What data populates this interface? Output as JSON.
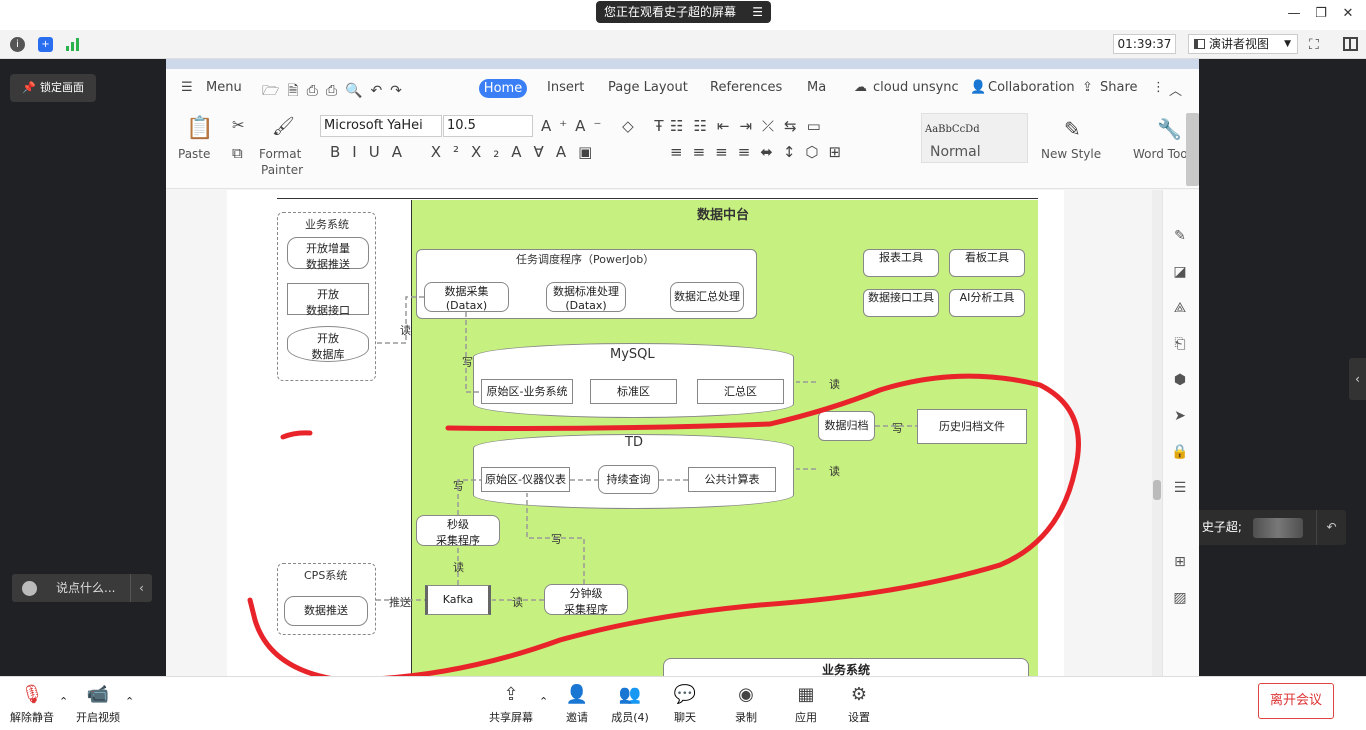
{
  "window": {
    "share_banner": "您正在观看史子超的屏幕",
    "timer": "01:39:37",
    "view_mode": "演讲者视图"
  },
  "left_panel": {
    "lock_label": "锁定画面",
    "chat_placeholder": "说点什么..."
  },
  "speaking": {
    "label": "正在讲话: 史子超;"
  },
  "editor": {
    "menu_label": "Menu",
    "tabs": [
      "Home",
      "Insert",
      "Page Layout",
      "References",
      "Ma"
    ],
    "cloud": "cloud unsync",
    "collaboration": "Collaboration",
    "share": "Share",
    "paste": "Paste",
    "format_painter_1": "Format",
    "format_painter_2": "Painter",
    "font_name": "Microsoft YaHei",
    "font_size": "10.5",
    "style_preview": "AaBbCcDd",
    "style_name": "Normal",
    "new_style": "New Style",
    "word_tools": "Word Too"
  },
  "diagram": {
    "center_title": "数据中台",
    "biz_title": "业务系统",
    "biz_items": [
      [
        "开放增量",
        "数据推送"
      ],
      [
        "开放",
        "数据接口"
      ],
      [
        "开放",
        "数据库"
      ]
    ],
    "scheduler_title": "任务调度程序（PowerJob）",
    "sched_items": [
      [
        "数据采集",
        "(Datax)"
      ],
      [
        "数据标准处理",
        "(Datax)"
      ],
      [
        "数据汇总处理"
      ]
    ],
    "tools": [
      "报表工具",
      "看板工具",
      "数据接口工具",
      "AI分析工具"
    ],
    "mysql_title": "MySQL",
    "mysql_items": [
      "原始区-业务系统",
      "标准区",
      "汇总区"
    ],
    "td_title": "TD",
    "td_items": [
      "原始区-仪器仪表",
      "持续查询",
      "公共计算表"
    ],
    "archive": "数据归档",
    "archive_file": "历史归档文件",
    "sec_collector": [
      "秒级",
      "采集程序"
    ],
    "min_collector": [
      "分钟级",
      "采集程序"
    ],
    "cps_title": "CPS系统",
    "cps_item": "数据推送",
    "kafka": "Kafka",
    "bottom_biz": "业务系统",
    "read": "读",
    "write": "写",
    "push": "推送"
  },
  "bottom": {
    "unmute": "解除静音",
    "video": "开启视频",
    "share_screen": "共享屏幕",
    "invite": "邀请",
    "members": "成员(4)",
    "chat": "聊天",
    "record": "录制",
    "apps": "应用",
    "settings": "设置",
    "leave": "离开会议"
  },
  "colors": {
    "diagram_green": "#c6f080",
    "annotation_red": "#e8242a",
    "accent_blue": "#3b7ff6"
  }
}
